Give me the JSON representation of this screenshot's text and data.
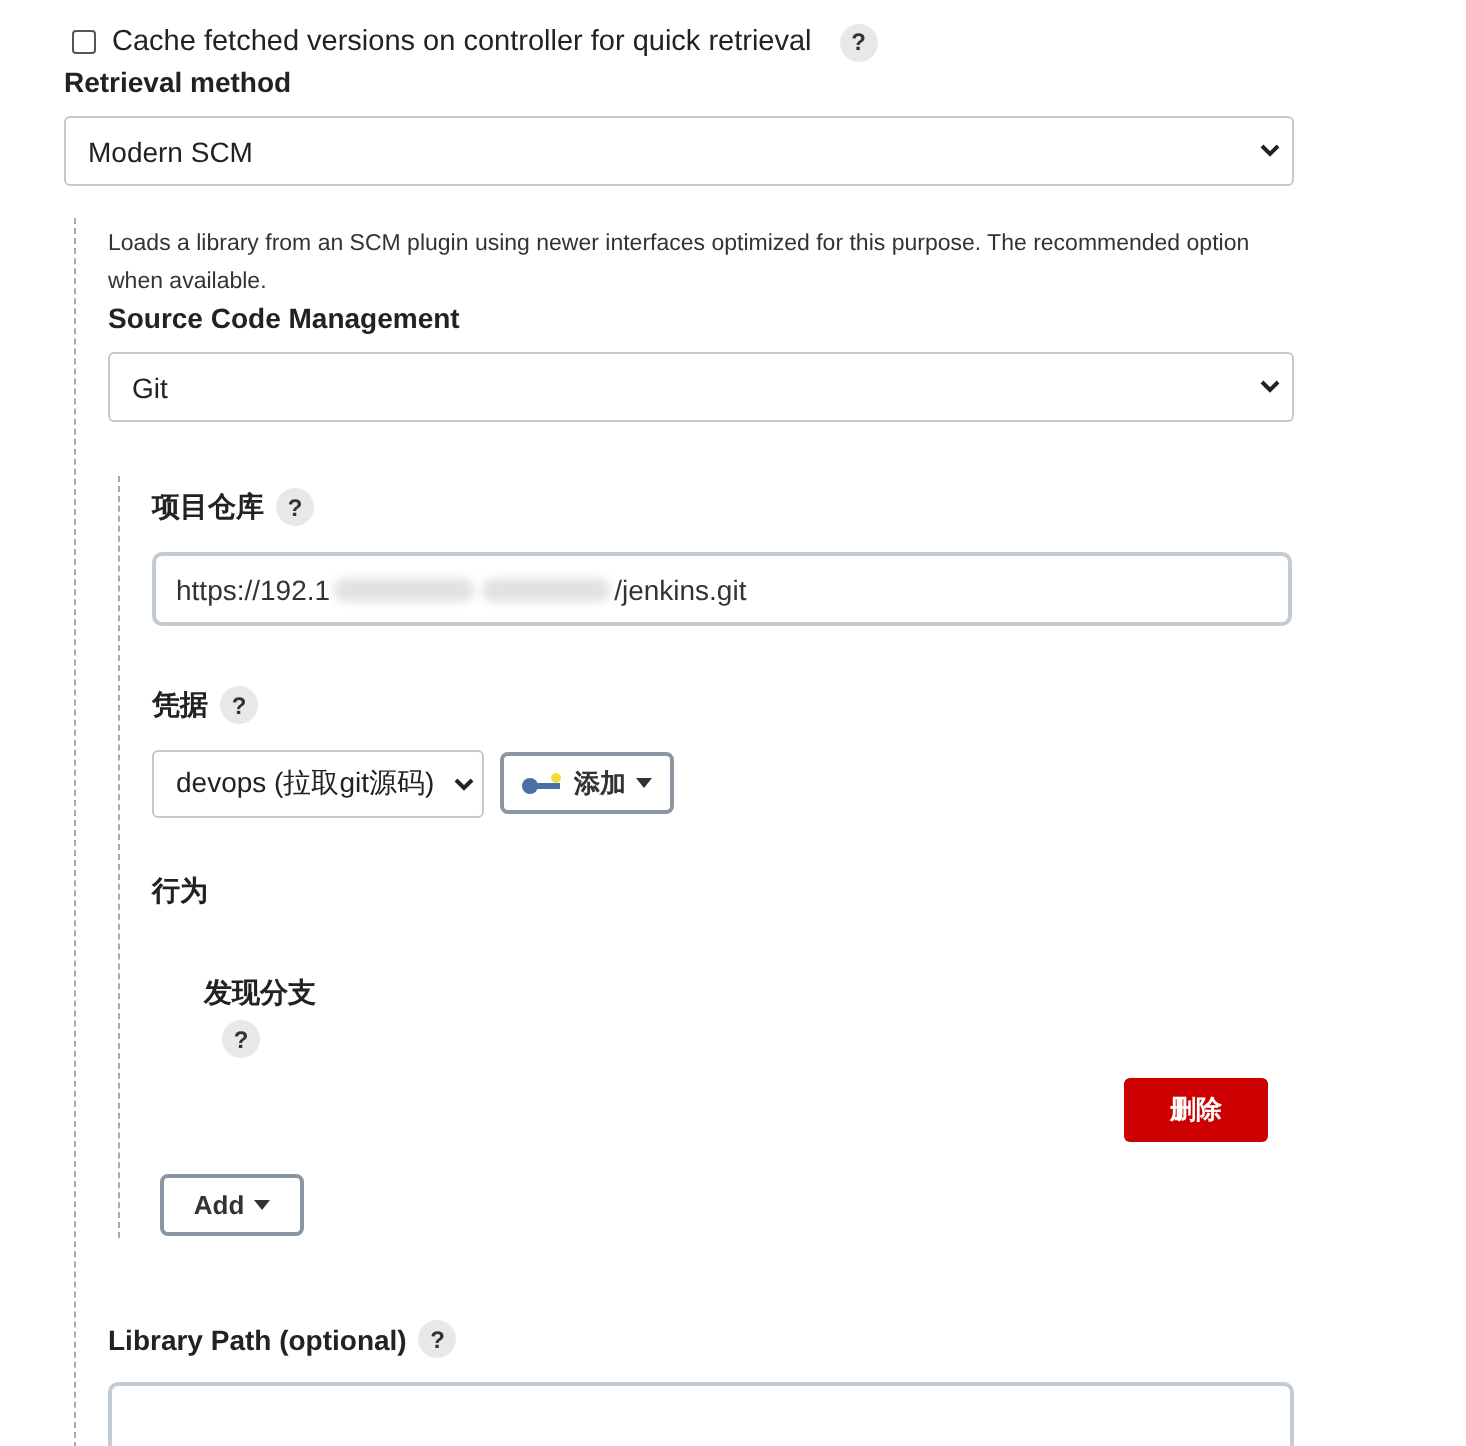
{
  "cache_option": {
    "label": "Cache fetched versions on controller for quick retrieval",
    "checked": false,
    "help": "?"
  },
  "retrieval_method": {
    "label": "Retrieval method",
    "value": "Modern SCM"
  },
  "retrieval_description": "Loads a library from an SCM plugin using newer interfaces optimized for this purpose. The recommended option when available.",
  "scm": {
    "label": "Source Code Management",
    "value": "Git"
  },
  "repository": {
    "label": "项目仓库",
    "help": "?",
    "value_start": "https://192.1",
    "value_end": "/jenkins.git"
  },
  "credentials": {
    "label": "凭据",
    "help": "?",
    "value": "devops (拉取git源码)",
    "add_button": "添加"
  },
  "behaviors": {
    "label": "行为",
    "items": [
      {
        "label": "发现分支",
        "help": "?",
        "delete_button": "删除"
      }
    ],
    "add_button": "Add"
  },
  "library_path": {
    "label": "Library Path (optional)",
    "help": "?"
  }
}
